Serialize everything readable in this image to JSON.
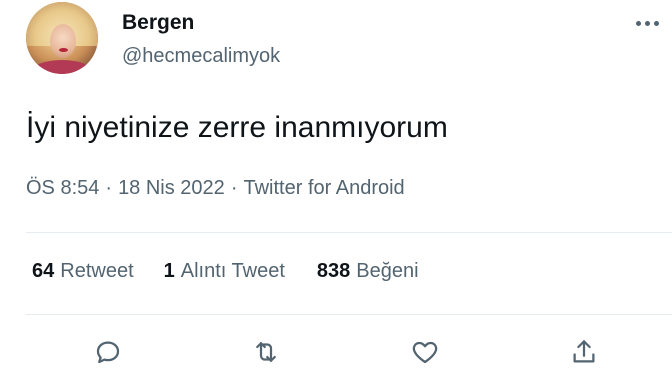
{
  "tweet": {
    "author": {
      "display_name": "Bergen",
      "handle": "@hecmecalimyok"
    },
    "text": "İyi niyetinize zerre inanmıyorum",
    "meta": {
      "time": "ÖS 8:54",
      "date": "18 Nis 2022",
      "source": "Twitter for Android",
      "separator": "·"
    },
    "stats": {
      "retweets": {
        "count": "64",
        "label": "Retweet"
      },
      "quotes": {
        "count": "1",
        "label": "Alıntı Tweet"
      },
      "likes": {
        "count": "838",
        "label": "Beğeni"
      }
    },
    "actions": {
      "icons": [
        "reply-icon",
        "retweet-icon",
        "like-icon",
        "share-icon"
      ]
    },
    "colors": {
      "text_primary": "#0f1419",
      "text_secondary": "#536471",
      "divider": "#e6ecf0"
    }
  }
}
